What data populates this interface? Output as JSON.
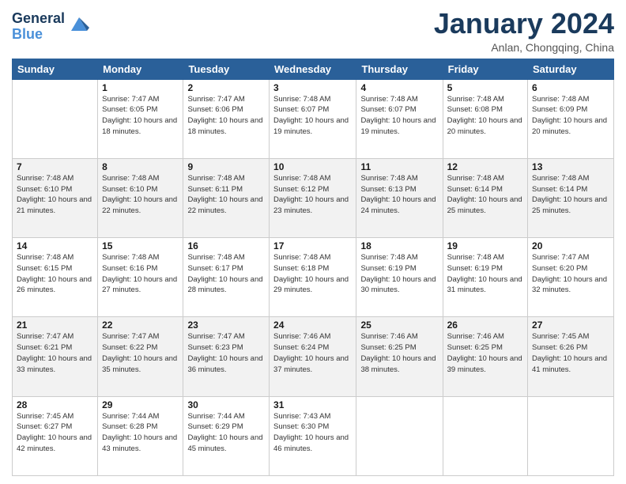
{
  "header": {
    "logo_line1": "General",
    "logo_line2": "Blue",
    "month_title": "January 2024",
    "subtitle": "Anlan, Chongqing, China"
  },
  "weekdays": [
    "Sunday",
    "Monday",
    "Tuesday",
    "Wednesday",
    "Thursday",
    "Friday",
    "Saturday"
  ],
  "weeks": [
    [
      {
        "day": "",
        "sunrise": "",
        "sunset": "",
        "daylight": ""
      },
      {
        "day": "1",
        "sunrise": "Sunrise: 7:47 AM",
        "sunset": "Sunset: 6:05 PM",
        "daylight": "Daylight: 10 hours and 18 minutes."
      },
      {
        "day": "2",
        "sunrise": "Sunrise: 7:47 AM",
        "sunset": "Sunset: 6:06 PM",
        "daylight": "Daylight: 10 hours and 18 minutes."
      },
      {
        "day": "3",
        "sunrise": "Sunrise: 7:48 AM",
        "sunset": "Sunset: 6:07 PM",
        "daylight": "Daylight: 10 hours and 19 minutes."
      },
      {
        "day": "4",
        "sunrise": "Sunrise: 7:48 AM",
        "sunset": "Sunset: 6:07 PM",
        "daylight": "Daylight: 10 hours and 19 minutes."
      },
      {
        "day": "5",
        "sunrise": "Sunrise: 7:48 AM",
        "sunset": "Sunset: 6:08 PM",
        "daylight": "Daylight: 10 hours and 20 minutes."
      },
      {
        "day": "6",
        "sunrise": "Sunrise: 7:48 AM",
        "sunset": "Sunset: 6:09 PM",
        "daylight": "Daylight: 10 hours and 20 minutes."
      }
    ],
    [
      {
        "day": "7",
        "sunrise": "Sunrise: 7:48 AM",
        "sunset": "Sunset: 6:10 PM",
        "daylight": "Daylight: 10 hours and 21 minutes."
      },
      {
        "day": "8",
        "sunrise": "Sunrise: 7:48 AM",
        "sunset": "Sunset: 6:10 PM",
        "daylight": "Daylight: 10 hours and 22 minutes."
      },
      {
        "day": "9",
        "sunrise": "Sunrise: 7:48 AM",
        "sunset": "Sunset: 6:11 PM",
        "daylight": "Daylight: 10 hours and 22 minutes."
      },
      {
        "day": "10",
        "sunrise": "Sunrise: 7:48 AM",
        "sunset": "Sunset: 6:12 PM",
        "daylight": "Daylight: 10 hours and 23 minutes."
      },
      {
        "day": "11",
        "sunrise": "Sunrise: 7:48 AM",
        "sunset": "Sunset: 6:13 PM",
        "daylight": "Daylight: 10 hours and 24 minutes."
      },
      {
        "day": "12",
        "sunrise": "Sunrise: 7:48 AM",
        "sunset": "Sunset: 6:14 PM",
        "daylight": "Daylight: 10 hours and 25 minutes."
      },
      {
        "day": "13",
        "sunrise": "Sunrise: 7:48 AM",
        "sunset": "Sunset: 6:14 PM",
        "daylight": "Daylight: 10 hours and 25 minutes."
      }
    ],
    [
      {
        "day": "14",
        "sunrise": "Sunrise: 7:48 AM",
        "sunset": "Sunset: 6:15 PM",
        "daylight": "Daylight: 10 hours and 26 minutes."
      },
      {
        "day": "15",
        "sunrise": "Sunrise: 7:48 AM",
        "sunset": "Sunset: 6:16 PM",
        "daylight": "Daylight: 10 hours and 27 minutes."
      },
      {
        "day": "16",
        "sunrise": "Sunrise: 7:48 AM",
        "sunset": "Sunset: 6:17 PM",
        "daylight": "Daylight: 10 hours and 28 minutes."
      },
      {
        "day": "17",
        "sunrise": "Sunrise: 7:48 AM",
        "sunset": "Sunset: 6:18 PM",
        "daylight": "Daylight: 10 hours and 29 minutes."
      },
      {
        "day": "18",
        "sunrise": "Sunrise: 7:48 AM",
        "sunset": "Sunset: 6:19 PM",
        "daylight": "Daylight: 10 hours and 30 minutes."
      },
      {
        "day": "19",
        "sunrise": "Sunrise: 7:48 AM",
        "sunset": "Sunset: 6:19 PM",
        "daylight": "Daylight: 10 hours and 31 minutes."
      },
      {
        "day": "20",
        "sunrise": "Sunrise: 7:47 AM",
        "sunset": "Sunset: 6:20 PM",
        "daylight": "Daylight: 10 hours and 32 minutes."
      }
    ],
    [
      {
        "day": "21",
        "sunrise": "Sunrise: 7:47 AM",
        "sunset": "Sunset: 6:21 PM",
        "daylight": "Daylight: 10 hours and 33 minutes."
      },
      {
        "day": "22",
        "sunrise": "Sunrise: 7:47 AM",
        "sunset": "Sunset: 6:22 PM",
        "daylight": "Daylight: 10 hours and 35 minutes."
      },
      {
        "day": "23",
        "sunrise": "Sunrise: 7:47 AM",
        "sunset": "Sunset: 6:23 PM",
        "daylight": "Daylight: 10 hours and 36 minutes."
      },
      {
        "day": "24",
        "sunrise": "Sunrise: 7:46 AM",
        "sunset": "Sunset: 6:24 PM",
        "daylight": "Daylight: 10 hours and 37 minutes."
      },
      {
        "day": "25",
        "sunrise": "Sunrise: 7:46 AM",
        "sunset": "Sunset: 6:25 PM",
        "daylight": "Daylight: 10 hours and 38 minutes."
      },
      {
        "day": "26",
        "sunrise": "Sunrise: 7:46 AM",
        "sunset": "Sunset: 6:25 PM",
        "daylight": "Daylight: 10 hours and 39 minutes."
      },
      {
        "day": "27",
        "sunrise": "Sunrise: 7:45 AM",
        "sunset": "Sunset: 6:26 PM",
        "daylight": "Daylight: 10 hours and 41 minutes."
      }
    ],
    [
      {
        "day": "28",
        "sunrise": "Sunrise: 7:45 AM",
        "sunset": "Sunset: 6:27 PM",
        "daylight": "Daylight: 10 hours and 42 minutes."
      },
      {
        "day": "29",
        "sunrise": "Sunrise: 7:44 AM",
        "sunset": "Sunset: 6:28 PM",
        "daylight": "Daylight: 10 hours and 43 minutes."
      },
      {
        "day": "30",
        "sunrise": "Sunrise: 7:44 AM",
        "sunset": "Sunset: 6:29 PM",
        "daylight": "Daylight: 10 hours and 45 minutes."
      },
      {
        "day": "31",
        "sunrise": "Sunrise: 7:43 AM",
        "sunset": "Sunset: 6:30 PM",
        "daylight": "Daylight: 10 hours and 46 minutes."
      },
      {
        "day": "",
        "sunrise": "",
        "sunset": "",
        "daylight": ""
      },
      {
        "day": "",
        "sunrise": "",
        "sunset": "",
        "daylight": ""
      },
      {
        "day": "",
        "sunrise": "",
        "sunset": "",
        "daylight": ""
      }
    ]
  ]
}
